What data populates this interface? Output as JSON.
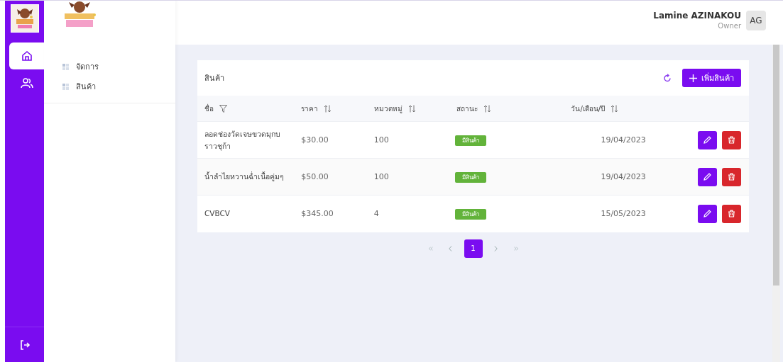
{
  "rail": {
    "items": [
      {
        "kind": "home",
        "selected": true
      },
      {
        "kind": "users",
        "selected": false
      }
    ]
  },
  "menu": [
    {
      "label": "จัดการ"
    },
    {
      "label": "สินค้า"
    }
  ],
  "user": {
    "name": "Lamine AZINAKOU",
    "role": "Owner",
    "initials": "AG"
  },
  "card": {
    "title": "สินค้า",
    "add_button": "เพิ่มสินค้า"
  },
  "table": {
    "columns": [
      {
        "label": "ชื่อ",
        "kind": "filter"
      },
      {
        "label": "ราคา",
        "kind": "sort"
      },
      {
        "label": "หมวดหมู่",
        "kind": "sort"
      },
      {
        "label": "สถานะ",
        "kind": "sort"
      },
      {
        "label": "วัน/เดือน/ปี",
        "kind": "sort"
      }
    ],
    "rows": [
      {
        "name": "ลอดช่องวัดเจษขวดมุกบราวชุก้า",
        "price": "$30.00",
        "category": "100",
        "status": "มีสินค้า",
        "date": "19/04/2023"
      },
      {
        "name": "น้ำลำไยหวานฉ่ำเนื้อคู่มๆ",
        "price": "$50.00",
        "category": "100",
        "status": "มีสินค้า",
        "date": "19/04/2023"
      },
      {
        "name": "CVBCV",
        "price": "$345.00",
        "category": "4",
        "status": "มีสินค้า",
        "date": "15/05/2023"
      }
    ]
  },
  "pagination": {
    "pages": [
      {
        "label": "1",
        "selected": true
      }
    ]
  }
}
